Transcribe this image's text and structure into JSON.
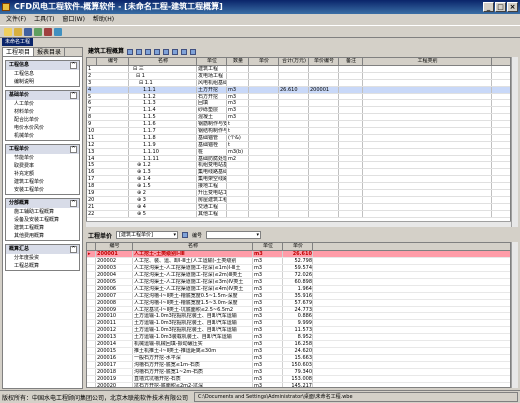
{
  "window": {
    "title": "CFD风电工程软件-概算软件 - [未命名工程-建筑工程概算]"
  },
  "menu": [
    "文件(F)",
    "工具(T)",
    "窗口(W)",
    "帮助(H)"
  ],
  "doc_tab": "未命名工程",
  "left_tabs": [
    "工程项目",
    "报表目录"
  ],
  "panels": [
    {
      "title": "工程信息",
      "items": [
        "工程信息",
        "编制说明"
      ]
    },
    {
      "title": "基础单价",
      "items": [
        "人工单价",
        "材料单价",
        "配合比单价",
        "电价水价风价",
        "机械单价"
      ]
    },
    {
      "title": "工程单价",
      "items": [
        "节能单价",
        "取费费率",
        "补充定额",
        "建筑工程单价",
        "安装工程单价"
      ]
    },
    {
      "title": "分部概算",
      "items": [
        "施工辅助工程概算",
        "设备及安装工程概算",
        "建筑工程概算",
        "其他费用概算"
      ]
    },
    {
      "title": "概算汇总",
      "items": [
        "分年度投资",
        "工程总概算"
      ]
    }
  ],
  "upper_title": "建筑工程概算",
  "upper_cols": [
    "编号",
    "名称",
    "单位",
    "数量",
    "单价",
    "合计(万元)",
    "单价编号",
    "备注",
    "工程类别"
  ],
  "upper_rows": [
    [
      "1",
      "⊟ 三",
      "建筑工程",
      "",
      "",
      "",
      "",
      "",
      ""
    ],
    [
      "2",
      "⊟ 1",
      "发电场工程",
      "",
      "",
      "",
      "",
      "",
      ""
    ],
    [
      "3",
      "⊟ 1.1",
      "风电机组基础工程",
      "",
      "",
      "",
      "",
      "",
      ""
    ],
    [
      "4",
      "1.1.1",
      "土方开挖",
      "m3",
      "",
      "26.610",
      "200001",
      "",
      ""
    ],
    [
      "5",
      "1.1.2",
      "石方开挖",
      "m3",
      "",
      "",
      "",
      "",
      ""
    ],
    [
      "6",
      "1.1.3",
      "回填",
      "m3",
      "",
      "",
      "",
      "",
      ""
    ],
    [
      "7",
      "1.1.4",
      "砂砾垫层",
      "m3",
      "",
      "",
      "",
      "",
      ""
    ],
    [
      "8",
      "1.1.5",
      "混凝土",
      "m3",
      "",
      "",
      "",
      "",
      ""
    ],
    [
      "9",
      "1.1.6",
      "钢筋制作与安装",
      "t",
      "",
      "",
      "",
      "",
      ""
    ],
    [
      "10",
      "1.1.7",
      "钢结构制作与安装",
      "t",
      "",
      "",
      "",
      "",
      ""
    ],
    [
      "11",
      "1.1.8",
      "基础锚管",
      "(个&)",
      "",
      "",
      "",
      "",
      ""
    ],
    [
      "12",
      "1.1.9",
      "基础锚栓",
      "t",
      "",
      "",
      "",
      "",
      ""
    ],
    [
      "13",
      "1.1.10",
      "桩",
      "m3(b)",
      "",
      "",
      "",
      "",
      ""
    ],
    [
      "14",
      "1.1.11",
      "基础防腐处理",
      "m2",
      "",
      "",
      "",
      "",
      ""
    ],
    [
      "15",
      "⊕ 1.2",
      "机组变电站基础工程",
      "",
      "",
      "",
      "",
      "",
      ""
    ],
    [
      "16",
      "⊕ 1.3",
      "集电线路基础工程",
      "",
      "",
      "",
      "",
      "",
      ""
    ],
    [
      "17",
      "⊕ 1.4",
      "集电架空线路工程",
      "",
      "",
      "",
      "",
      "",
      ""
    ],
    [
      "18",
      "⊕ 1.5",
      "接地工程",
      "",
      "",
      "",
      "",
      "",
      ""
    ],
    [
      "19",
      "⊕ 2",
      "升压变电站工程",
      "",
      "",
      "",
      "",
      "",
      ""
    ],
    [
      "20",
      "⊕ 3",
      "房屋建筑工程",
      "",
      "",
      "",
      "",
      "",
      ""
    ],
    [
      "21",
      "⊕ 4",
      "交通工程",
      "",
      "",
      "",
      "",
      "",
      ""
    ],
    [
      "22",
      "⊕ 5",
      "其他工程",
      "",
      "",
      "",
      "",
      "",
      ""
    ]
  ],
  "lower_title": "工程单价",
  "lower_combo": "[建筑工程单价]",
  "lower_search_label": "编号",
  "lower_cols": [
    "编号",
    "名称",
    "单位",
    "单价"
  ],
  "lower_rows": [
    [
      "200001",
      "人工挖土-土类级别Ⅰ-Ⅲ",
      "m3",
      "26.610"
    ],
    [
      "200002",
      "人工挖、装、运、卸Ⅰ-Ⅲ土(人工运输)-土类级别",
      "m3",
      "52.798"
    ],
    [
      "200003",
      "人工挖沟渠土-人工挖渠道施工-挖深(≤1m)Ⅰ-Ⅲ土",
      "m3",
      "59.574"
    ],
    [
      "200004",
      "人工挖沟渠土-人工挖渠道施工-挖深(≤2m)Ⅲ类土",
      "m3",
      "72.026"
    ],
    [
      "200005",
      "人工挖沟渠土-人工挖渠道施工-挖深(≤3m)Ⅳ类土",
      "m3",
      "60.898"
    ],
    [
      "200006",
      "人工挖沟渠土-人工挖渠道施工-挖深(≤4m)Ⅳ类土",
      "m3",
      "1.964"
    ],
    [
      "200007",
      "人工挖沟槽-Ⅰ~Ⅱ类土-槽底宽度0.5~1.5m-深度",
      "m3",
      "35.916"
    ],
    [
      "200008",
      "人工挖沟槽-Ⅰ~Ⅱ类土-槽底宽度1.5~3.0m-深度",
      "m3",
      "57.679"
    ],
    [
      "200009",
      "人工挖基坑-Ⅰ~Ⅱ类土-坑底面积≤2.5~6.5m2",
      "m3",
      "24.773"
    ],
    [
      "200010",
      "土方运输-1.0m3挖掘机挖装土、自卸汽车运输",
      "m3",
      "0.886"
    ],
    [
      "200011",
      "土方运输-1.0m3挖掘机挖装土、自卸汽车运输",
      "m3",
      "9.999"
    ],
    [
      "200012",
      "土方运输-1.0m3挖掘机挖装土、自卸汽车运输",
      "m3",
      "11.573"
    ],
    [
      "200013",
      "土方运输-1.0m3装载机装土、自卸汽车运输",
      "m3",
      "8.952"
    ],
    [
      "200014",
      "机械运输-机械回填-振动碾压实",
      "m3",
      "16.258"
    ],
    [
      "200015",
      "推土机推土-Ⅰ~Ⅱ类土-推运距离≤30m",
      "m3",
      "24.620"
    ],
    [
      "200016",
      "一般石方开挖-水平深",
      "m3",
      "15.663"
    ],
    [
      "200017",
      "沟槽石方开挖-底宽≤1m-石质",
      "m3",
      "150.603"
    ],
    [
      "200018",
      "沟槽石方开挖-底宽1~2m-石质",
      "m3",
      "79.340"
    ],
    [
      "200019",
      "直墙式坑槽开挖-石质",
      "m3",
      "153.008"
    ],
    [
      "200020",
      "坑石方开挖-底面积≤2m2-坑深",
      "m3",
      "145.217"
    ]
  ],
  "status": {
    "owner": "版权所有：中国水电工程顾问集团公司，北京木联能软件技术有限公司",
    "path": "C:\\Documents and Settings\\Administrator\\桌面\\未命名工程.wbe"
  }
}
